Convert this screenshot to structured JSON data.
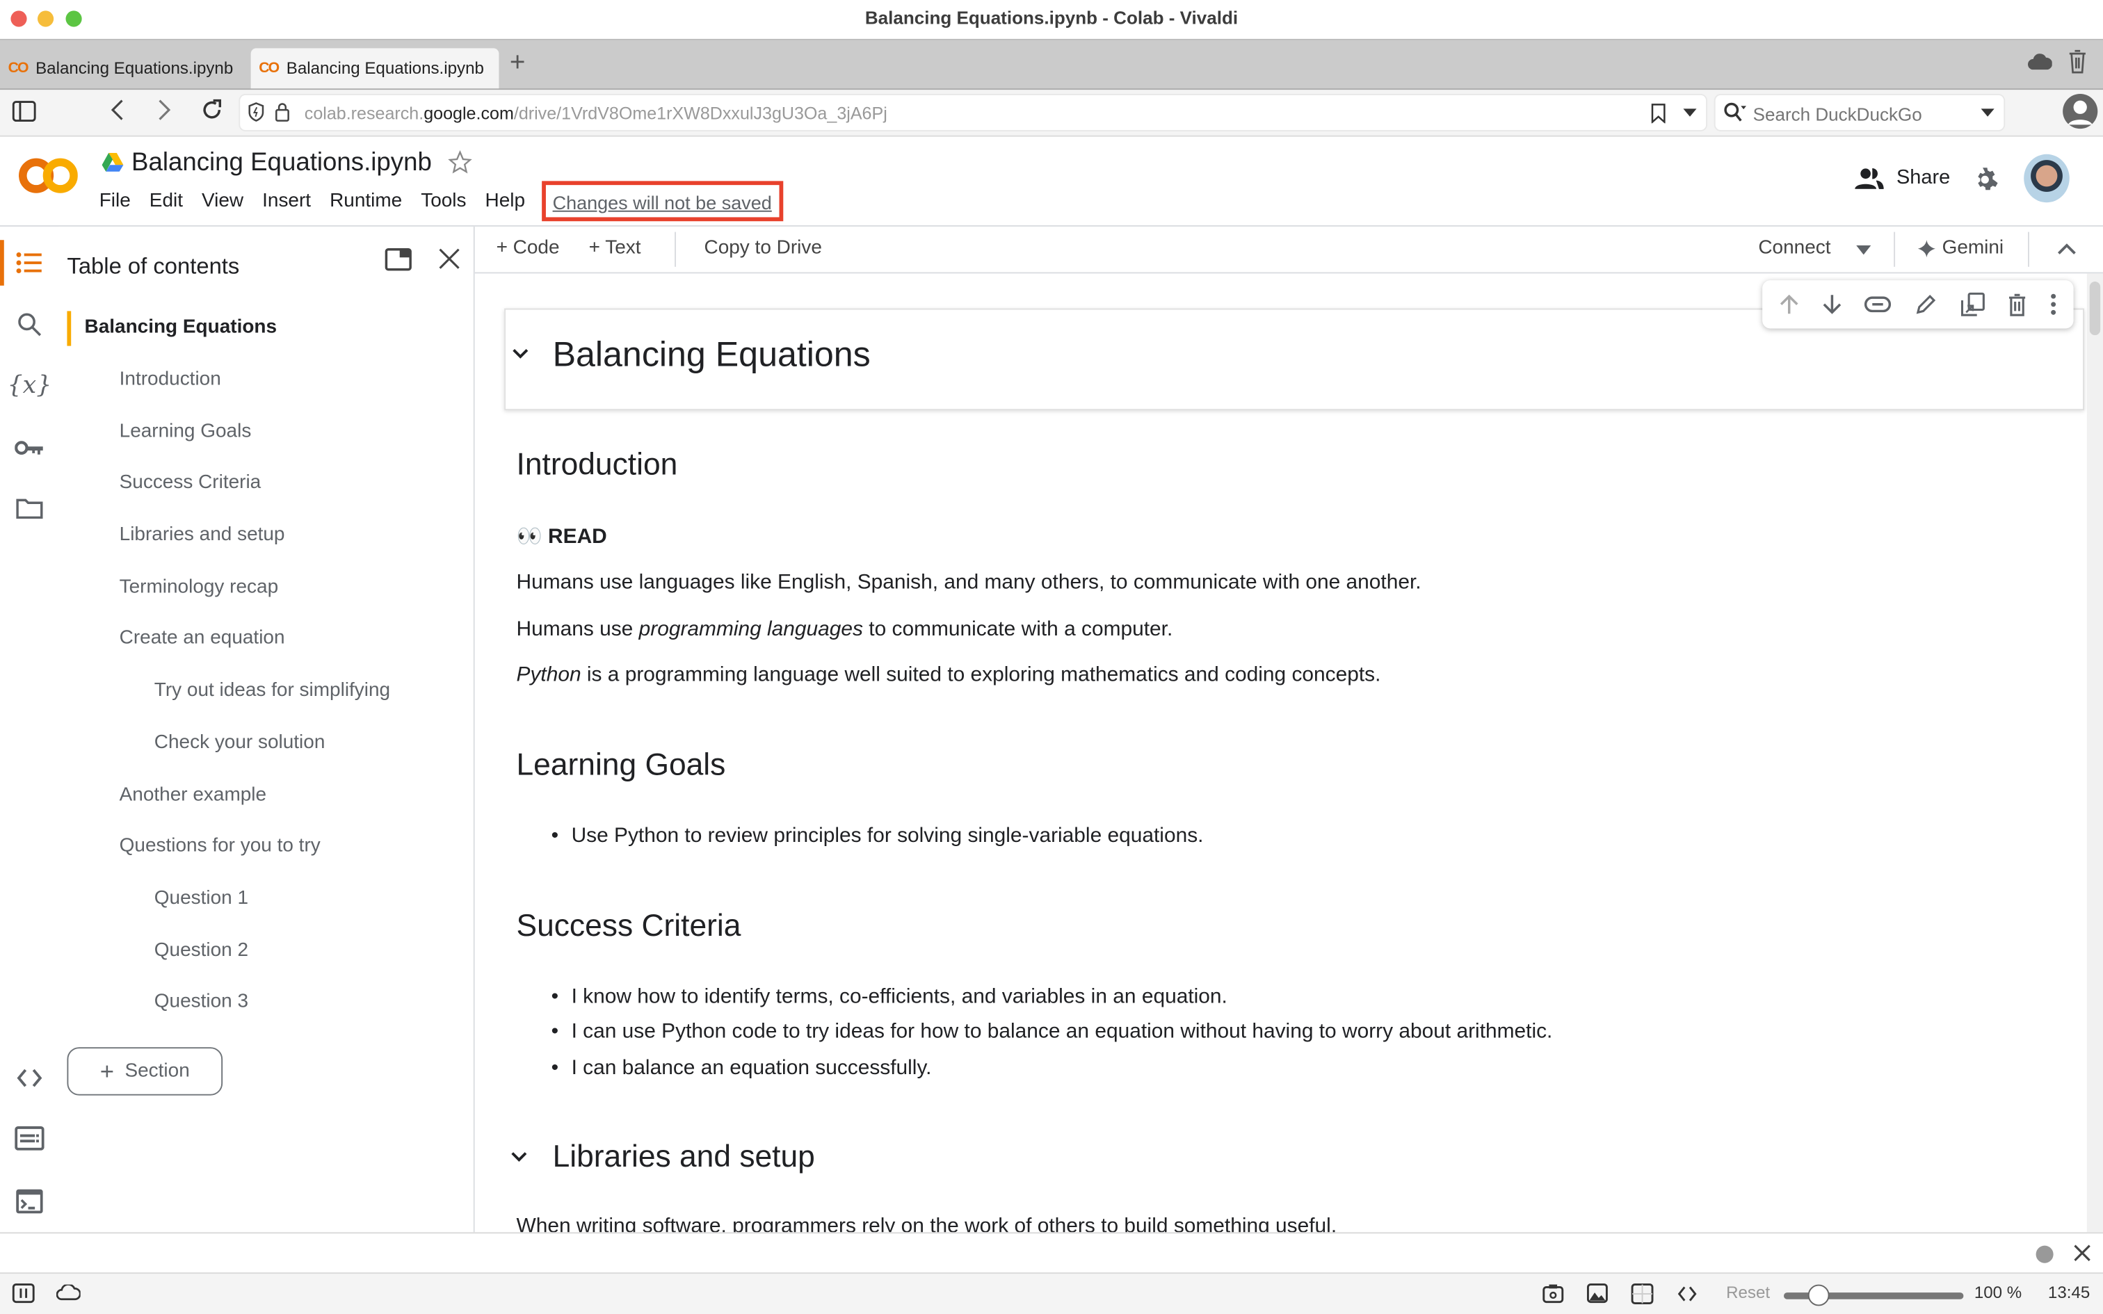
{
  "window": {
    "title": "Balancing Equations.ipynb - Colab - Vivaldi"
  },
  "tabs": [
    {
      "label": "Balancing Equations.ipynb",
      "active": false
    },
    {
      "label": "Balancing Equations.ipynb",
      "active": true
    }
  ],
  "new_tab_label": "+",
  "address_bar": {
    "url_prefix": "colab.research.",
    "url_domain": "google.com",
    "url_path": "/drive/1VrdV8Ome1rXW8DxxulJ3gU3Oa_3jA6Pj"
  },
  "search_box": {
    "placeholder": "Search DuckDuckGo"
  },
  "colab": {
    "logo_text": "CO",
    "notebook_title": "Balancing Equations.ipynb",
    "menu": [
      "File",
      "Edit",
      "View",
      "Insert",
      "Runtime",
      "Tools",
      "Help"
    ],
    "unsaved_notice": "Changes will not be saved",
    "share_label": "Share",
    "accent_color": "#e8710a",
    "highlight_color": "#e8412c"
  },
  "toolbar": {
    "add_code": "Code",
    "add_text": "Text",
    "copy_to_drive": "Copy to Drive",
    "connect": "Connect",
    "gemini": "Gemini"
  },
  "toc": {
    "title": "Table of contents",
    "items": [
      {
        "label": "Balancing Equations",
        "level": 1
      },
      {
        "label": "Introduction",
        "level": 2
      },
      {
        "label": "Learning Goals",
        "level": 2
      },
      {
        "label": "Success Criteria",
        "level": 2
      },
      {
        "label": "Libraries and setup",
        "level": 2
      },
      {
        "label": "Terminology recap",
        "level": 2
      },
      {
        "label": "Create an equation",
        "level": 2
      },
      {
        "label": "Try out ideas for simplifying",
        "level": 3
      },
      {
        "label": "Check your solution",
        "level": 3
      },
      {
        "label": "Another example",
        "level": 2
      },
      {
        "label": "Questions for you to try",
        "level": 2
      },
      {
        "label": "Question 1",
        "level": 3
      },
      {
        "label": "Question 2",
        "level": 3
      },
      {
        "label": "Question 3",
        "level": 3
      }
    ],
    "section_button": "Section"
  },
  "notebook": {
    "title": "Balancing Equations",
    "intro_heading": "Introduction",
    "read_emoji": "👀",
    "read_label": "READ",
    "intro_p1": "Humans use languages like English, Spanish, and many others, to communicate with one another.",
    "intro_p2_a": "Humans use ",
    "intro_p2_em": "programming languages",
    "intro_p2_b": " to communicate with a computer.",
    "intro_p3_em": "Python",
    "intro_p3_b": " is a programming language well suited to exploring mathematics and coding concepts.",
    "goals_heading": "Learning Goals",
    "goals": [
      "Use Python to review principles for solving single-variable equations."
    ],
    "criteria_heading": "Success Criteria",
    "criteria": [
      "I know how to identify terms, co-efficients, and variables in an equation.",
      "I can use Python code to try ideas for how to balance an equation without having to worry about arithmetic.",
      "I can balance an equation successfully."
    ],
    "libraries_heading": "Libraries and setup",
    "libraries_p1": "When writing software, programmers rely on the work of others to build something useful."
  },
  "statusbar": {
    "reset_label": "Reset",
    "zoom_level": "100 %",
    "zoom_fraction": 0.15,
    "clock": "13:45"
  }
}
